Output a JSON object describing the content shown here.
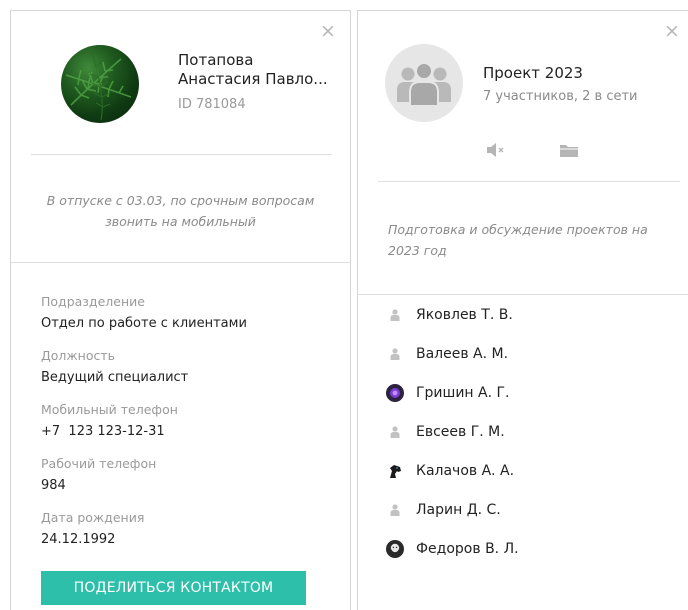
{
  "contact": {
    "name": "Потапова Анастасия Павло...",
    "name_line1": "Потапова",
    "name_line2": "Анастасия Павло...",
    "id": "ID 781084",
    "status": "В отпуске с 03.03, по срочным вопросам звонить на мобильный",
    "fields": [
      {
        "label": "Подразделение",
        "value": "Отдел по работе с клиентами"
      },
      {
        "label": "Должность",
        "value": "Ведущий специалист"
      },
      {
        "label": "Мобильный телефон",
        "value": "+7  123 123-12-31"
      },
      {
        "label": "Рабочий телефон",
        "value": "984"
      },
      {
        "label": "Дата рождения",
        "value": "24.12.1992"
      }
    ],
    "share_button": "ПОДЕЛИТЬСЯ КОНТАКТОМ",
    "close_glyph": "×"
  },
  "group": {
    "title": "Проект 2023",
    "subtitle": "7 участников, 2 в сети",
    "description": "Подготовка и обсуждение проектов на 2023 год",
    "close_glyph": "×",
    "members": [
      {
        "name": "Яковлев Т. В.",
        "avatar": "default-person-icon"
      },
      {
        "name": "Валеев А. М.",
        "avatar": "default-person-icon"
      },
      {
        "name": "Гришин А. Г.",
        "avatar": "purple-avatar-icon"
      },
      {
        "name": "Евсеев Г. М.",
        "avatar": "default-person-icon"
      },
      {
        "name": "Калачов А. А.",
        "avatar": "horse-avatar-icon"
      },
      {
        "name": "Ларин Д. С.",
        "avatar": "default-person-icon"
      },
      {
        "name": "Федоров В. Л.",
        "avatar": "bearded-man-avatar-icon"
      }
    ]
  },
  "colors": {
    "accent": "#2ebfaa",
    "muted_text": "#8a8a8a",
    "divider": "#e0e0e0"
  }
}
